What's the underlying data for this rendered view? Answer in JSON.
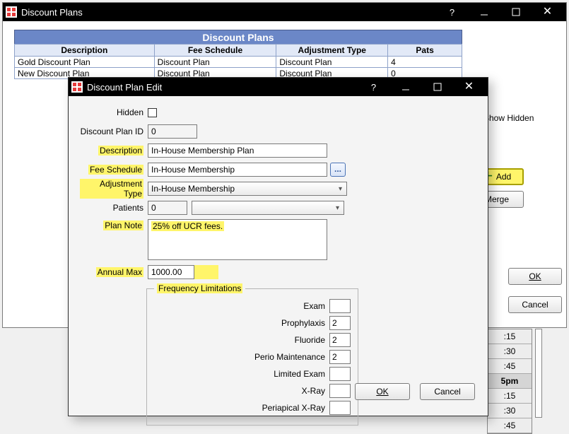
{
  "parent": {
    "title": "Discount Plans",
    "help": "?",
    "table_title": "Discount Plans",
    "cols": [
      "Description",
      "Fee Schedule",
      "Adjustment Type",
      "Pats"
    ],
    "rows": [
      {
        "desc": "Gold Discount Plan",
        "fee": "Discount Plan",
        "adj": "Discount Plan",
        "pats": "4"
      },
      {
        "desc": "New Discount Plan",
        "fee": "Discount Plan",
        "adj": "Discount Plan",
        "pats": "0"
      }
    ],
    "show_hidden": "Show Hidden",
    "add": "Add",
    "merge": "Merge",
    "ok": "OK",
    "cancel": "Cancel"
  },
  "modal": {
    "title": "Discount Plan Edit",
    "help": "?",
    "hidden_label": "Hidden",
    "id_label": "Discount Plan ID",
    "id_value": "0",
    "desc_label": "Description",
    "desc_value": "In-House Membership Plan",
    "fee_label": "Fee Schedule",
    "fee_value": "In-House Membership",
    "adj_label": "Adjustment Type",
    "adj_value": "In-House Membership",
    "patients_label": "Patients",
    "patients_value": "0",
    "note_label": "Plan Note",
    "note_value": "25% off UCR fees.",
    "max_label": "Annual Max",
    "max_value": "1000.00",
    "freq_legend": "Frequency Limitations",
    "freq": {
      "exam_label": "Exam",
      "exam_value": "",
      "prophy_label": "Prophylaxis",
      "prophy_value": "2",
      "fluoride_label": "Fluoride",
      "fluoride_value": "2",
      "perio_label": "Perio Maintenance",
      "perio_value": "2",
      "lexam_label": "Limited Exam",
      "lexam_value": "",
      "xray_label": "X-Ray",
      "xray_value": "",
      "pxray_label": "Periapical X-Ray",
      "pxray_value": ""
    },
    "ok": "OK",
    "cancel": "Cancel",
    "ellipsis": "..."
  },
  "schedule": {
    "slots": [
      ":15",
      ":30",
      ":45",
      "5pm",
      ":15",
      ":30",
      ":45"
    ]
  }
}
